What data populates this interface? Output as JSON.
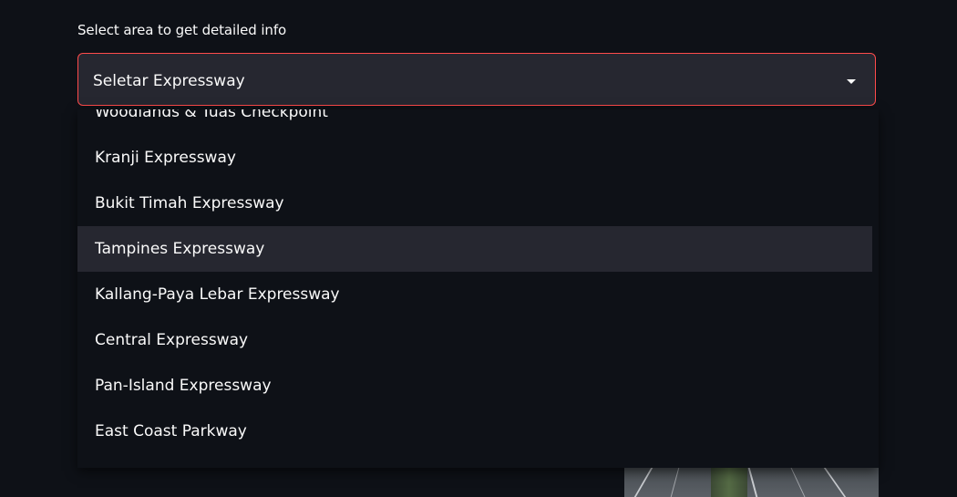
{
  "select": {
    "label": "Select area to get detailed info",
    "value": "Seletar Expressway"
  },
  "dropdown": {
    "options": [
      "Woodlands & Tuas Checkpoint",
      "Kranji Expressway",
      "Bukit Timah Expressway",
      "Tampines Expressway",
      "Kallang-Paya Lebar Expressway",
      "Central Expressway",
      "Pan-Island Expressway",
      "East Coast Parkway"
    ],
    "highlighted_option": "Tampines Expressway"
  },
  "colors": {
    "background": "#0e1117",
    "select_background": "#262730",
    "focus_border": "#ff4b4b",
    "highlight": "#262730",
    "text": "#fafafa"
  },
  "icons": {
    "select_arrow": "chevron-down-icon"
  }
}
